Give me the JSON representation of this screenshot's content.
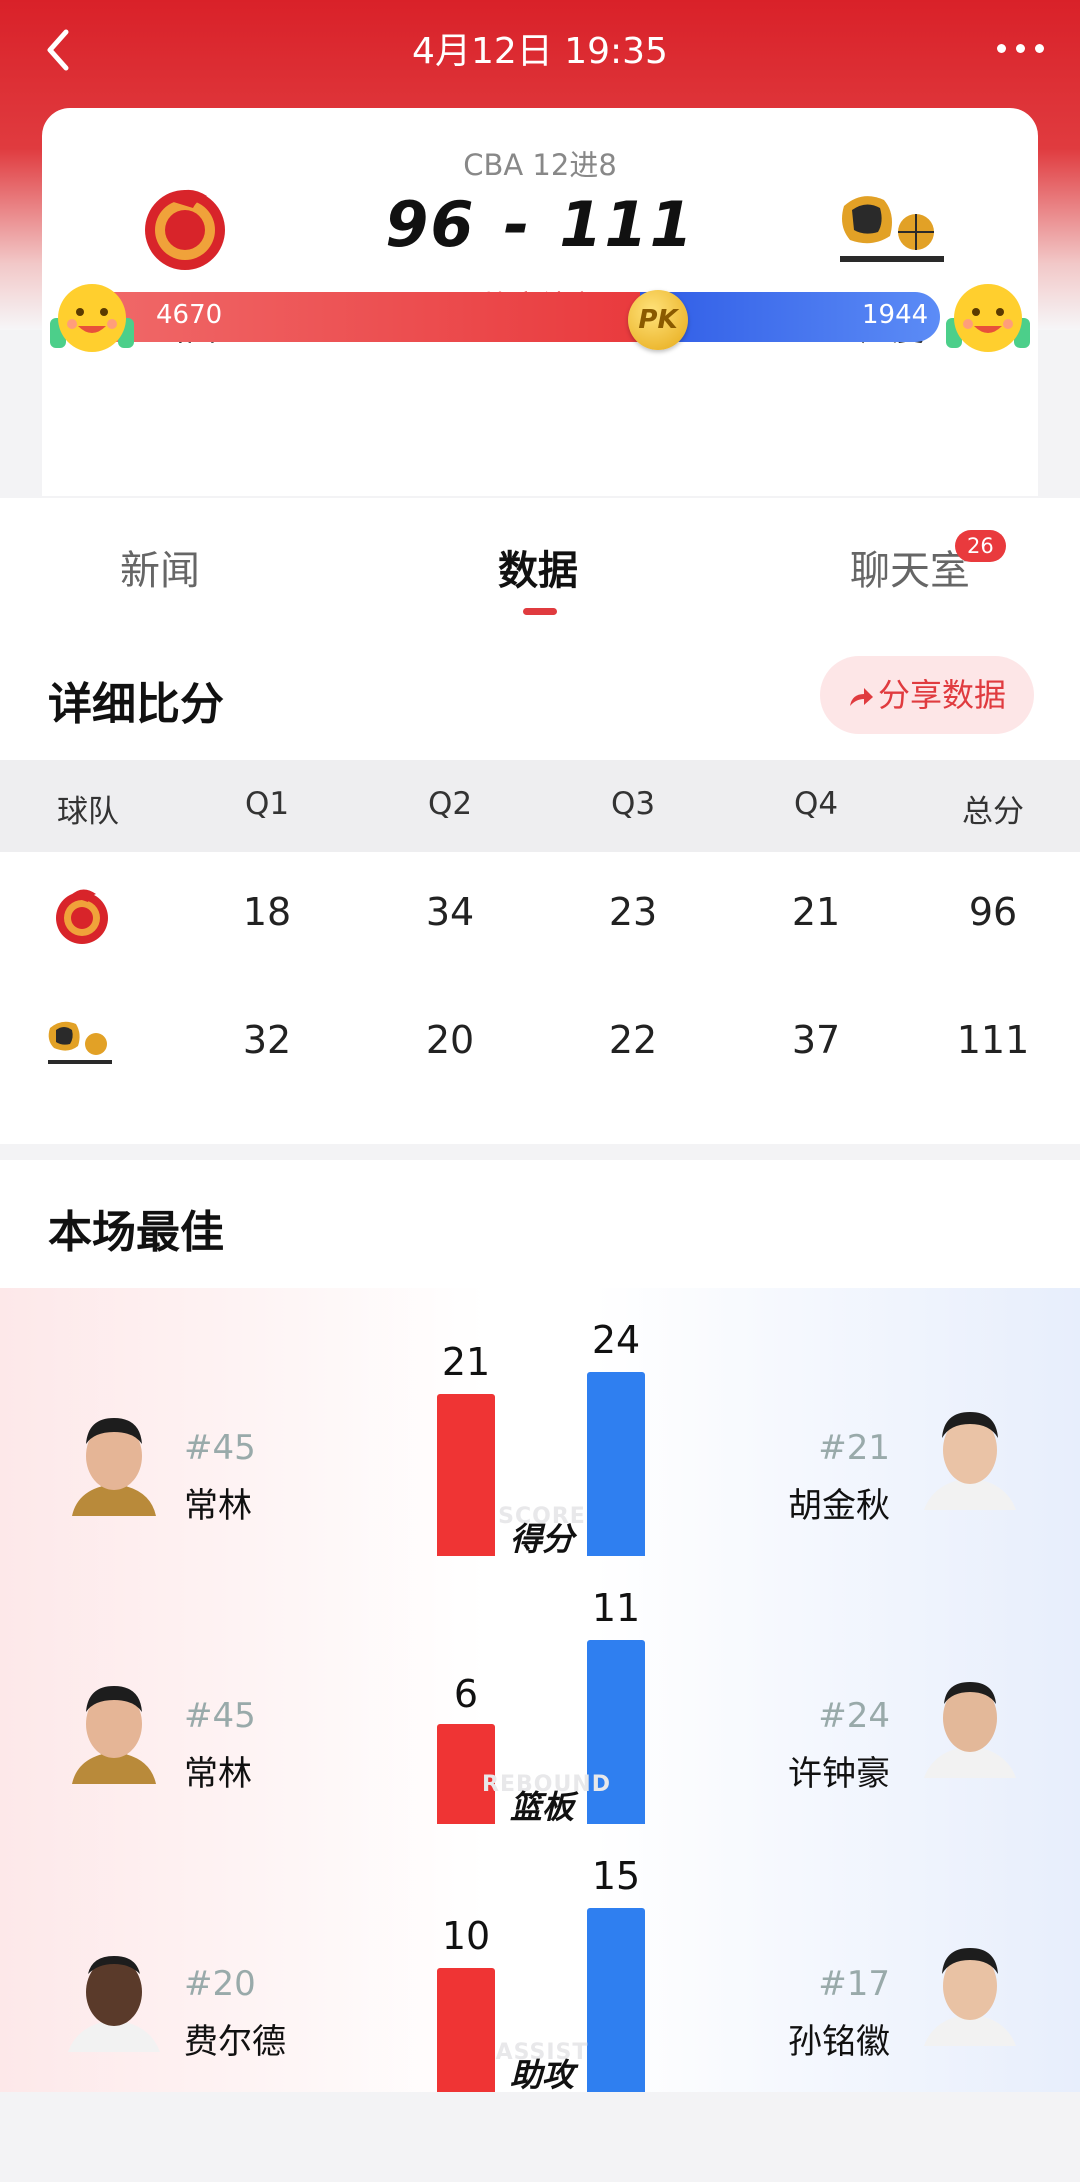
{
  "header": {
    "datetime": "4月12日 19:35"
  },
  "match": {
    "league": "CBA 12进8",
    "home_score": "96",
    "away_score": "111",
    "separator": "-",
    "status": "比赛结束",
    "home_team": "山西",
    "away_team": "广厦",
    "home_support": "4670",
    "away_support": "1944",
    "pk_label": "PK"
  },
  "tabs": [
    {
      "label": "新闻"
    },
    {
      "label": "数据"
    },
    {
      "label": "聊天室",
      "badge": "26"
    }
  ],
  "detail": {
    "title": "详细比分",
    "share_label": "分享数据",
    "headers": [
      "球队",
      "Q1",
      "Q2",
      "Q3",
      "Q4",
      "总分"
    ],
    "rows": [
      {
        "team": "山西",
        "q": [
          "18",
          "34",
          "23",
          "21",
          "96"
        ]
      },
      {
        "team": "广厦",
        "q": [
          "32",
          "20",
          "22",
          "37",
          "111"
        ]
      }
    ]
  },
  "best": {
    "title": "本场最佳",
    "stats": [
      {
        "label": "得分",
        "ghost": "SCORE",
        "home": {
          "number": "#45",
          "name": "常林",
          "value": "21"
        },
        "away": {
          "number": "#21",
          "name": "胡金秋",
          "value": "24"
        }
      },
      {
        "label": "篮板",
        "ghost": "REBOUND",
        "home": {
          "number": "#45",
          "name": "常林",
          "value": "6"
        },
        "away": {
          "number": "#24",
          "name": "许钟豪",
          "value": "11"
        }
      },
      {
        "label": "助攻",
        "ghost": "ASSIST",
        "home": {
          "number": "#20",
          "name": "费尔德",
          "value": "10"
        },
        "away": {
          "number": "#17",
          "name": "孙铭徽",
          "value": "15"
        }
      }
    ]
  },
  "colors": {
    "accent": "#e03b3f",
    "home": "#ef3434",
    "away": "#2f7ff0"
  }
}
